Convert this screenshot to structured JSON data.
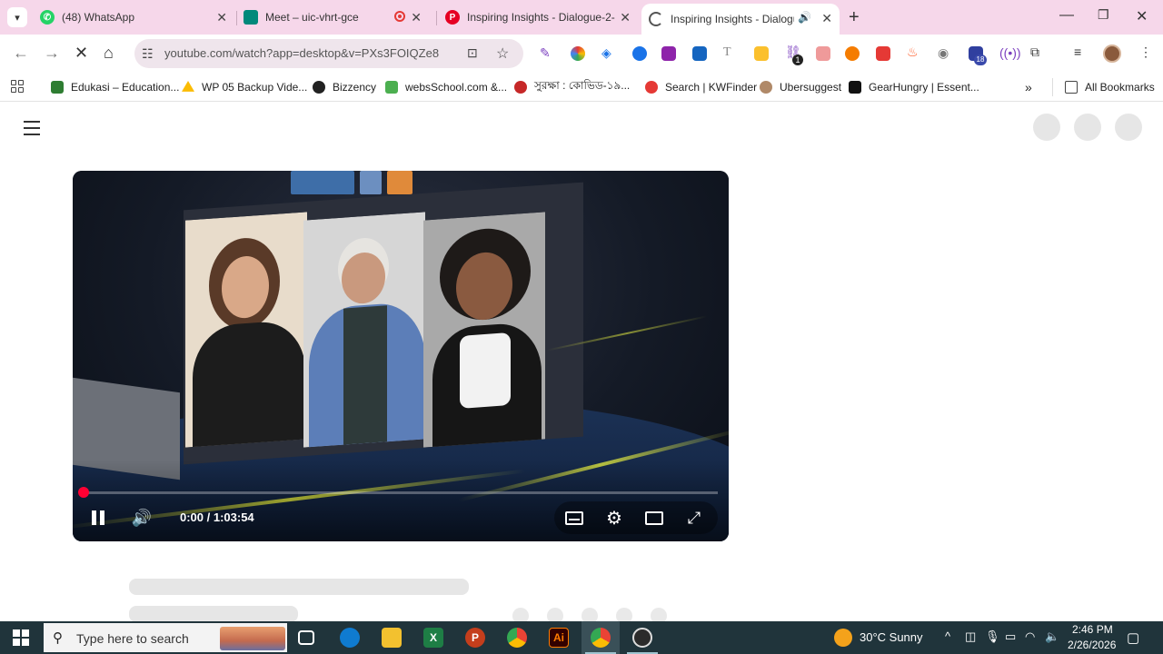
{
  "browser": {
    "tabs": [
      {
        "title": "(48) WhatsApp",
        "favicon": "whatsapp-icon",
        "color": "#25d366"
      },
      {
        "title": "Meet – uic-vhrt-gce",
        "favicon": "google-meet-icon",
        "color": "#00897b"
      },
      {
        "title": "Inspiring Insights - Dialogue-2-",
        "favicon": "pinterest-icon",
        "color": "#e60023"
      },
      {
        "title": "Inspiring Insights - Dialogue",
        "favicon": "loading-icon",
        "color": "#555555",
        "active": true
      }
    ],
    "address": {
      "url": "youtube.com/watch?app=desktop&v=PXs3FOIQZe8"
    },
    "bookmarks": [
      {
        "label": "Edukasi – Education...",
        "icon": "edukasi-icon",
        "color": "#2e7d32"
      },
      {
        "label": "WP 05 Backup Vide...",
        "icon": "google-drive-icon",
        "color": "#fbbc04"
      },
      {
        "label": "Bizzency",
        "icon": "bizzency-icon",
        "color": "#222222"
      },
      {
        "label": "websSchool.com &...",
        "icon": "websschool-icon",
        "color": "#4caf50"
      },
      {
        "label": "সুরক্ষা : কোভিড-১৯...",
        "icon": "surokkha-icon",
        "color": "#c62828"
      },
      {
        "label": "Search | KWFinder",
        "icon": "kwfinder-icon",
        "color": "#e53935"
      },
      {
        "label": "Ubersuggest",
        "icon": "ubersuggest-icon",
        "color": "#b08968"
      },
      {
        "label": "GearHungry | Essent...",
        "icon": "gearhungry-icon",
        "color": "#111111"
      }
    ],
    "all_bookmarks": "All Bookmarks",
    "extension_badge_1": "1",
    "extension_badge_18": "18"
  },
  "video": {
    "time": "0:00 / 1:03:54",
    "progress": 0.0
  },
  "taskbar": {
    "search_placeholder": "Type here to search",
    "weather": "30°C  Sunny",
    "time": "2:46 PM",
    "date": "2/26/2026",
    "apps": [
      {
        "name": "task-view-icon"
      },
      {
        "name": "edge-icon",
        "color": "#0f7bd0"
      },
      {
        "name": "file-explorer-icon",
        "color": "#f3c12f"
      },
      {
        "name": "excel-icon",
        "color": "#1e7e45"
      },
      {
        "name": "powerpoint-icon",
        "color": "#c43e1c"
      },
      {
        "name": "chrome-icon",
        "color": "#4285f4"
      },
      {
        "name": "illustrator-icon",
        "color": "#ff7c00"
      },
      {
        "name": "chrome-profile-icon",
        "color": "#4285f4"
      },
      {
        "name": "obs-icon",
        "color": "#2b2b2b"
      }
    ]
  }
}
